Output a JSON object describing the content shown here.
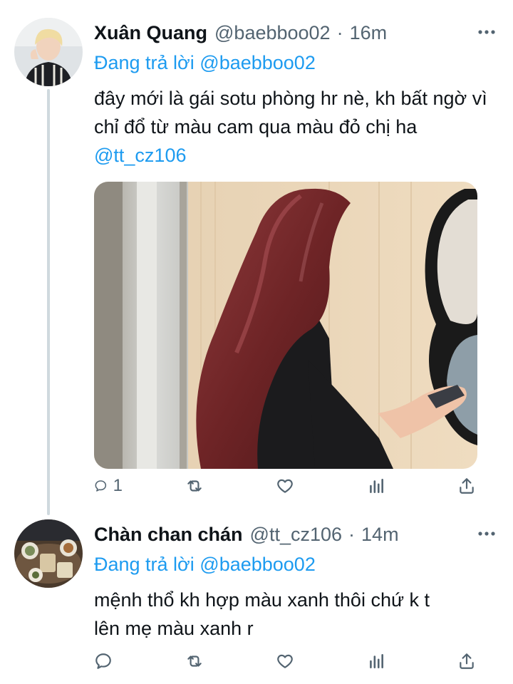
{
  "colors": {
    "accent": "#1d9bf0",
    "text": "#0f1419",
    "secondary": "#536471",
    "thread_line": "#cfd9de"
  },
  "tweets": [
    {
      "display_name": "Xuân Quang",
      "handle": "@baebboo02",
      "separator": "·",
      "time": "16m",
      "more_icon": "more-horizontal-icon",
      "reply_label": "Đang trả lời",
      "reply_to": "@baebboo02",
      "text": "đây mới là gái sotu phòng hr nè, kh bất ngờ vì chỉ đổ từ màu cam qua màu đỏ chị ha",
      "mention": "@tt_cz106",
      "actions": {
        "reply_count": "1",
        "retweet_count": "",
        "like_count": ""
      },
      "image": "photo-woman-red-hair"
    },
    {
      "display_name": "Chàn chan chán",
      "handle": "@tt_cz106",
      "separator": "·",
      "time": "14m",
      "more_icon": "more-horizontal-icon",
      "reply_label": "Đang trả lời",
      "reply_to": "@baebboo02",
      "text_line1": "mệnh thổ kh hợp màu xanh thôi chứ k t",
      "text_line2": "lên mẹ màu xanh r",
      "actions": {
        "reply_count": "",
        "retweet_count": "",
        "like_count": ""
      }
    }
  ]
}
